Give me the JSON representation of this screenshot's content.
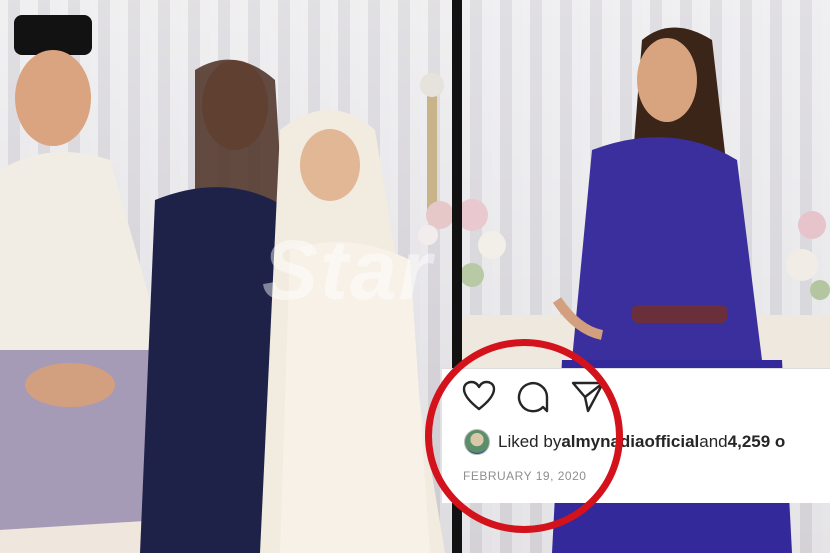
{
  "watermark": {
    "text": "Star"
  },
  "post": {
    "liked_prefix": "Liked by ",
    "liked_user": "almynadiaofficial",
    "liked_middle": " and ",
    "liked_count": "4,259 o",
    "date": "FEBRUARY 19, 2020"
  },
  "icons": [
    "heart-icon",
    "comment-icon",
    "share-icon"
  ],
  "colors": {
    "highlight_circle": "#d3121c",
    "navy_outfit": "#1e2248",
    "royal_blue_dress": "#3a2f9c",
    "cream_outfit": "#f2ebe0"
  }
}
